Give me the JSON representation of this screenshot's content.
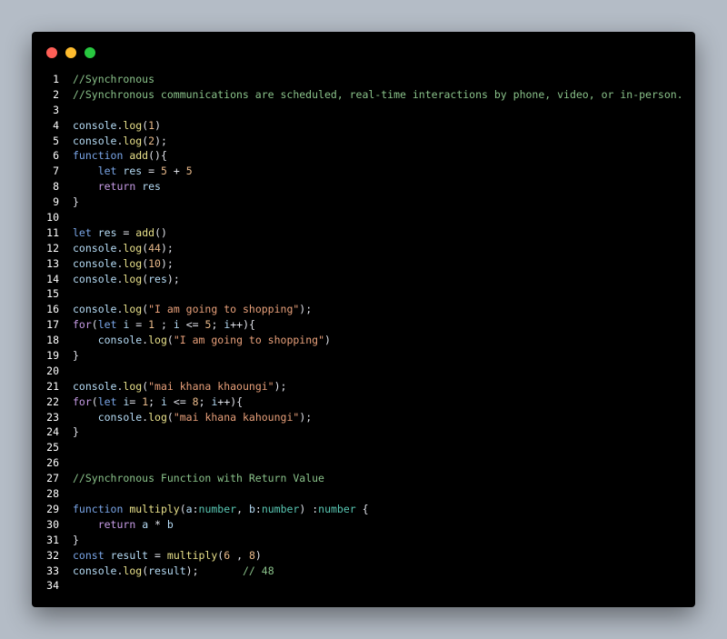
{
  "colors": {
    "page_background": "#b4bcc6",
    "editor_background": "#000000",
    "comment": "#8ac28a",
    "keyword": "#c79ce6",
    "function": "#e8e08a",
    "number": "#e8b98a",
    "string": "#e8a07a",
    "variable": "#b6dcf6",
    "type": "#59c8b4"
  },
  "window_controls": [
    "close-dot",
    "minimize-dot",
    "maximize-dot"
  ],
  "lines": [
    {
      "n": "1",
      "tokens": [
        {
          "t": "//Synchronous",
          "c": "comment"
        }
      ]
    },
    {
      "n": "2",
      "tokens": [
        {
          "t": "//Synchronous communications are scheduled, real-time interactions by phone, video, or in-person.",
          "c": "comment"
        }
      ]
    },
    {
      "n": "3",
      "tokens": []
    },
    {
      "n": "4",
      "tokens": [
        {
          "t": "console",
          "c": "var"
        },
        {
          "t": ".",
          "c": "default"
        },
        {
          "t": "log",
          "c": "func"
        },
        {
          "t": "(",
          "c": "default"
        },
        {
          "t": "1",
          "c": "number"
        },
        {
          "t": ")",
          "c": "default"
        }
      ]
    },
    {
      "n": "5",
      "tokens": [
        {
          "t": "console",
          "c": "var"
        },
        {
          "t": ".",
          "c": "default"
        },
        {
          "t": "log",
          "c": "func"
        },
        {
          "t": "(",
          "c": "default"
        },
        {
          "t": "2",
          "c": "number"
        },
        {
          "t": ");",
          "c": "default"
        }
      ]
    },
    {
      "n": "6",
      "tokens": [
        {
          "t": "function",
          "c": "blue"
        },
        {
          "t": " ",
          "c": "default"
        },
        {
          "t": "add",
          "c": "func"
        },
        {
          "t": "(){",
          "c": "default"
        }
      ]
    },
    {
      "n": "7",
      "tokens": [
        {
          "t": "    ",
          "c": "default"
        },
        {
          "t": "let",
          "c": "blue"
        },
        {
          "t": " ",
          "c": "default"
        },
        {
          "t": "res",
          "c": "var"
        },
        {
          "t": " = ",
          "c": "default"
        },
        {
          "t": "5",
          "c": "number"
        },
        {
          "t": " + ",
          "c": "default"
        },
        {
          "t": "5",
          "c": "number"
        }
      ]
    },
    {
      "n": "8",
      "tokens": [
        {
          "t": "    ",
          "c": "default"
        },
        {
          "t": "return",
          "c": "keyword"
        },
        {
          "t": " ",
          "c": "default"
        },
        {
          "t": "res",
          "c": "var"
        }
      ]
    },
    {
      "n": "9",
      "tokens": [
        {
          "t": "}",
          "c": "default"
        }
      ]
    },
    {
      "n": "10",
      "tokens": []
    },
    {
      "n": "11",
      "tokens": [
        {
          "t": "let",
          "c": "blue"
        },
        {
          "t": " ",
          "c": "default"
        },
        {
          "t": "res",
          "c": "var"
        },
        {
          "t": " = ",
          "c": "default"
        },
        {
          "t": "add",
          "c": "func"
        },
        {
          "t": "()",
          "c": "default"
        }
      ]
    },
    {
      "n": "12",
      "tokens": [
        {
          "t": "console",
          "c": "var"
        },
        {
          "t": ".",
          "c": "default"
        },
        {
          "t": "log",
          "c": "func"
        },
        {
          "t": "(",
          "c": "default"
        },
        {
          "t": "44",
          "c": "number"
        },
        {
          "t": ");",
          "c": "default"
        }
      ]
    },
    {
      "n": "13",
      "tokens": [
        {
          "t": "console",
          "c": "var"
        },
        {
          "t": ".",
          "c": "default"
        },
        {
          "t": "log",
          "c": "func"
        },
        {
          "t": "(",
          "c": "default"
        },
        {
          "t": "10",
          "c": "number"
        },
        {
          "t": ");",
          "c": "default"
        }
      ]
    },
    {
      "n": "14",
      "tokens": [
        {
          "t": "console",
          "c": "var"
        },
        {
          "t": ".",
          "c": "default"
        },
        {
          "t": "log",
          "c": "func"
        },
        {
          "t": "(",
          "c": "default"
        },
        {
          "t": "res",
          "c": "var"
        },
        {
          "t": ");",
          "c": "default"
        }
      ]
    },
    {
      "n": "15",
      "tokens": []
    },
    {
      "n": "16",
      "tokens": [
        {
          "t": "console",
          "c": "var"
        },
        {
          "t": ".",
          "c": "default"
        },
        {
          "t": "log",
          "c": "func"
        },
        {
          "t": "(",
          "c": "default"
        },
        {
          "t": "\"I am going to shopping\"",
          "c": "string"
        },
        {
          "t": ");",
          "c": "default"
        }
      ]
    },
    {
      "n": "17",
      "tokens": [
        {
          "t": "for",
          "c": "keyword"
        },
        {
          "t": "(",
          "c": "default"
        },
        {
          "t": "let",
          "c": "blue"
        },
        {
          "t": " ",
          "c": "default"
        },
        {
          "t": "i",
          "c": "var"
        },
        {
          "t": " = ",
          "c": "default"
        },
        {
          "t": "1",
          "c": "number"
        },
        {
          "t": " ; ",
          "c": "default"
        },
        {
          "t": "i",
          "c": "var"
        },
        {
          "t": " <= ",
          "c": "default"
        },
        {
          "t": "5",
          "c": "number"
        },
        {
          "t": "; ",
          "c": "default"
        },
        {
          "t": "i",
          "c": "var"
        },
        {
          "t": "++){",
          "c": "default"
        }
      ]
    },
    {
      "n": "18",
      "tokens": [
        {
          "t": "    ",
          "c": "default"
        },
        {
          "t": "console",
          "c": "var"
        },
        {
          "t": ".",
          "c": "default"
        },
        {
          "t": "log",
          "c": "func"
        },
        {
          "t": "(",
          "c": "default"
        },
        {
          "t": "\"I am going to shopping\"",
          "c": "string"
        },
        {
          "t": ")",
          "c": "default"
        }
      ]
    },
    {
      "n": "19",
      "tokens": [
        {
          "t": "}",
          "c": "default"
        }
      ]
    },
    {
      "n": "20",
      "tokens": []
    },
    {
      "n": "21",
      "tokens": [
        {
          "t": "console",
          "c": "var"
        },
        {
          "t": ".",
          "c": "default"
        },
        {
          "t": "log",
          "c": "func"
        },
        {
          "t": "(",
          "c": "default"
        },
        {
          "t": "\"mai khana khaoungi\"",
          "c": "string"
        },
        {
          "t": ");",
          "c": "default"
        }
      ]
    },
    {
      "n": "22",
      "tokens": [
        {
          "t": "for",
          "c": "keyword"
        },
        {
          "t": "(",
          "c": "default"
        },
        {
          "t": "let",
          "c": "blue"
        },
        {
          "t": " ",
          "c": "default"
        },
        {
          "t": "i",
          "c": "var"
        },
        {
          "t": "= ",
          "c": "default"
        },
        {
          "t": "1",
          "c": "number"
        },
        {
          "t": "; ",
          "c": "default"
        },
        {
          "t": "i",
          "c": "var"
        },
        {
          "t": " <= ",
          "c": "default"
        },
        {
          "t": "8",
          "c": "number"
        },
        {
          "t": "; ",
          "c": "default"
        },
        {
          "t": "i",
          "c": "var"
        },
        {
          "t": "++){",
          "c": "default"
        }
      ]
    },
    {
      "n": "23",
      "tokens": [
        {
          "t": "    ",
          "c": "default"
        },
        {
          "t": "console",
          "c": "var"
        },
        {
          "t": ".",
          "c": "default"
        },
        {
          "t": "log",
          "c": "func"
        },
        {
          "t": "(",
          "c": "default"
        },
        {
          "t": "\"mai khana kahoungi\"",
          "c": "string"
        },
        {
          "t": ");",
          "c": "default"
        }
      ]
    },
    {
      "n": "24",
      "tokens": [
        {
          "t": "}",
          "c": "default"
        }
      ]
    },
    {
      "n": "25",
      "tokens": []
    },
    {
      "n": "26",
      "tokens": []
    },
    {
      "n": "27",
      "tokens": [
        {
          "t": "//Synchronous Function with Return Value",
          "c": "comment"
        }
      ]
    },
    {
      "n": "28",
      "tokens": []
    },
    {
      "n": "29",
      "tokens": [
        {
          "t": "function",
          "c": "blue"
        },
        {
          "t": " ",
          "c": "default"
        },
        {
          "t": "multiply",
          "c": "func"
        },
        {
          "t": "(",
          "c": "default"
        },
        {
          "t": "a",
          "c": "var"
        },
        {
          "t": ":",
          "c": "default"
        },
        {
          "t": "number",
          "c": "type"
        },
        {
          "t": ", ",
          "c": "default"
        },
        {
          "t": "b",
          "c": "var"
        },
        {
          "t": ":",
          "c": "default"
        },
        {
          "t": "number",
          "c": "type"
        },
        {
          "t": ") ",
          "c": "default"
        },
        {
          "t": ":",
          "c": "default"
        },
        {
          "t": "number",
          "c": "type"
        },
        {
          "t": " {",
          "c": "default"
        }
      ]
    },
    {
      "n": "30",
      "tokens": [
        {
          "t": "    ",
          "c": "default"
        },
        {
          "t": "return",
          "c": "keyword"
        },
        {
          "t": " ",
          "c": "default"
        },
        {
          "t": "a",
          "c": "var"
        },
        {
          "t": " * ",
          "c": "default"
        },
        {
          "t": "b",
          "c": "var"
        }
      ]
    },
    {
      "n": "31",
      "tokens": [
        {
          "t": "}",
          "c": "default"
        }
      ]
    },
    {
      "n": "32",
      "tokens": [
        {
          "t": "const",
          "c": "blue"
        },
        {
          "t": " ",
          "c": "default"
        },
        {
          "t": "result",
          "c": "var"
        },
        {
          "t": " = ",
          "c": "default"
        },
        {
          "t": "multiply",
          "c": "func"
        },
        {
          "t": "(",
          "c": "default"
        },
        {
          "t": "6",
          "c": "number"
        },
        {
          "t": " , ",
          "c": "default"
        },
        {
          "t": "8",
          "c": "number"
        },
        {
          "t": ")",
          "c": "default"
        }
      ]
    },
    {
      "n": "33",
      "tokens": [
        {
          "t": "console",
          "c": "var"
        },
        {
          "t": ".",
          "c": "default"
        },
        {
          "t": "log",
          "c": "func"
        },
        {
          "t": "(",
          "c": "default"
        },
        {
          "t": "result",
          "c": "var"
        },
        {
          "t": ");",
          "c": "default"
        },
        {
          "t": "       ",
          "c": "default"
        },
        {
          "t": "// 48",
          "c": "comment"
        }
      ]
    },
    {
      "n": "34",
      "tokens": []
    }
  ]
}
